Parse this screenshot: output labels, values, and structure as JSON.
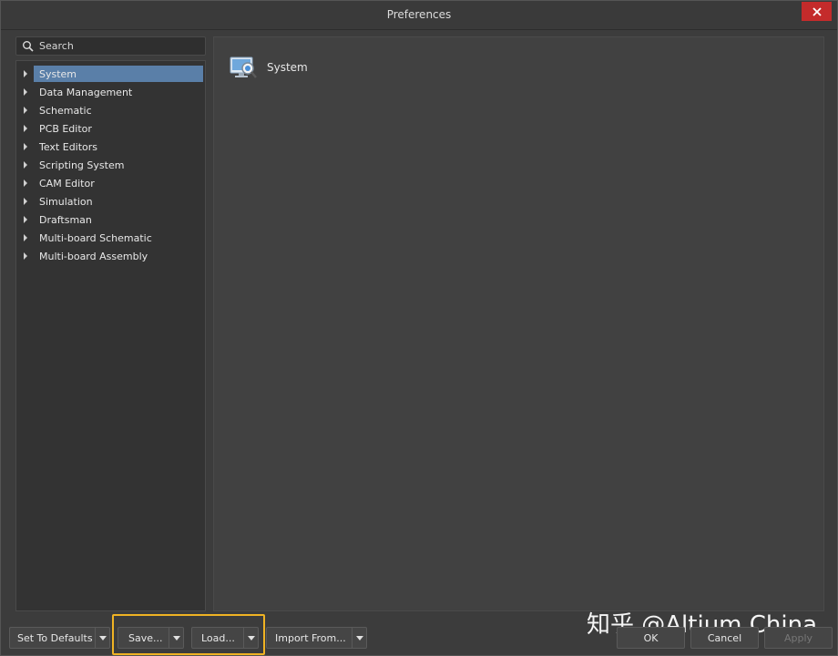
{
  "window": {
    "title": "Preferences",
    "close_icon": "close-icon"
  },
  "search": {
    "placeholder": "Search"
  },
  "tree": {
    "items": [
      {
        "label": "System",
        "selected": true
      },
      {
        "label": "Data Management"
      },
      {
        "label": "Schematic"
      },
      {
        "label": "PCB Editor"
      },
      {
        "label": "Text Editors"
      },
      {
        "label": "Scripting System"
      },
      {
        "label": "CAM Editor"
      },
      {
        "label": "Simulation"
      },
      {
        "label": "Draftsman"
      },
      {
        "label": "Multi-board Schematic"
      },
      {
        "label": "Multi-board Assembly"
      }
    ]
  },
  "content": {
    "title": "System",
    "icon": "system-preferences-icon"
  },
  "footer": {
    "set_to_defaults": "Set To Defaults",
    "save": "Save...",
    "load": "Load...",
    "import_from": "Import From...",
    "ok": "OK",
    "cancel": "Cancel",
    "apply": "Apply"
  },
  "watermark": "知乎 @Altium China",
  "colors": {
    "accent_selection": "#5a7fa8",
    "highlight": "#f0b323",
    "close": "#c42b2b"
  }
}
